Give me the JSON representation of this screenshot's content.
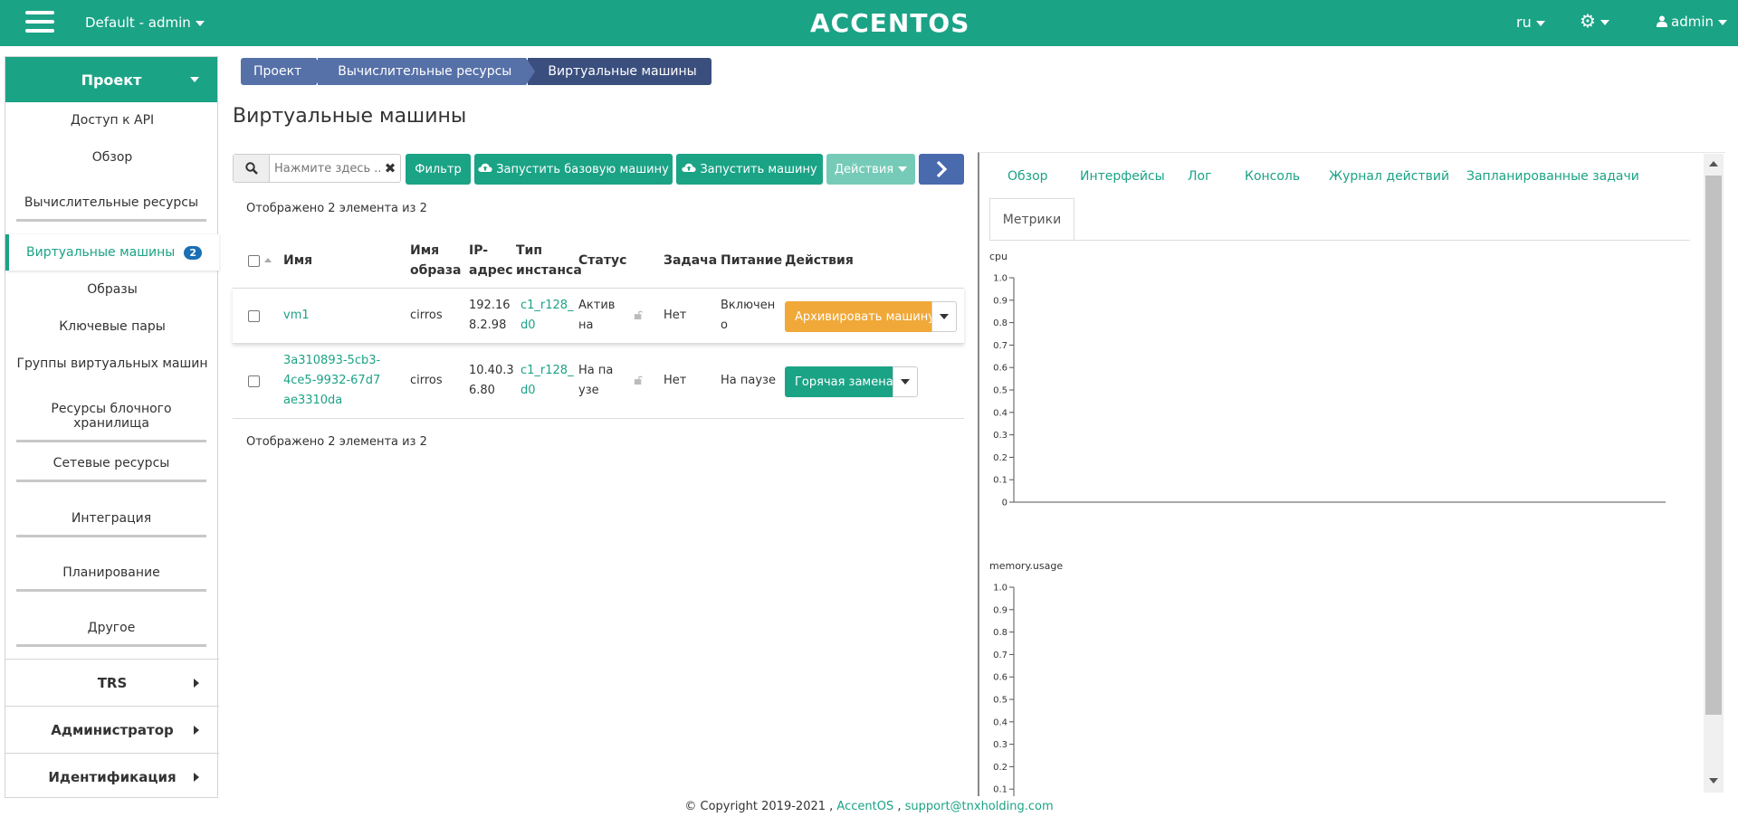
{
  "topbar": {
    "project": "Default - admin",
    "logo": "ACCENTOS",
    "lang": "ru",
    "user": "admin"
  },
  "sidebar": {
    "project_label": "Проект",
    "items": [
      "Доступ к API",
      "Обзор",
      "Вычислительные ресурсы",
      "Виртуальные машины",
      "Образы",
      "Ключевые пары",
      "Группы виртуальных машин",
      "Ресурсы блочного хранилища",
      "Сетевые ресурсы",
      "Интеграция",
      "Планирование",
      "Другое"
    ],
    "active_badge": "2",
    "sections": [
      "TRS",
      "Администратор",
      "Идентификация"
    ]
  },
  "breadcrumb": [
    "Проект",
    "Вычислительные ресурсы",
    "Виртуальные машины"
  ],
  "page_title": "Виртуальные машины",
  "toolbar": {
    "search_placeholder": "Нажмите здесь ...",
    "filter": "Фильтр",
    "launch_base": "Запустить базовую машину",
    "launch": "Запустить машину",
    "actions": "Действия"
  },
  "count_text": "Отображено 2 элемента из 2",
  "table": {
    "headers": {
      "name": "Имя",
      "image_1": "Имя",
      "image_2": "образа",
      "ip_1": "IP-",
      "ip_2": "адрес",
      "type_1": "Тип",
      "type_2": "инстанса",
      "status": "Статус",
      "task": "Задача",
      "power": "Питание",
      "actions": "Действия"
    },
    "rows": [
      {
        "name": "vm1",
        "image": "cirros",
        "ip_1": "192.16",
        "ip_2": "8.2.98",
        "type_1": "c1_r128_",
        "type_2": "d0",
        "status_1": "Актив",
        "status_2": "на",
        "task": "Нет",
        "power_1": "Включен",
        "power_2": "о",
        "action": "Архивировать машину",
        "action_color": "#f0a838"
      },
      {
        "name_1": "3a310893-5cb3-",
        "name_2": "4ce5-9932-67d7",
        "name_3": "ae3310da",
        "image": "cirros",
        "ip_1": "10.40.3",
        "ip_2": "6.80",
        "type_1": "c1_r128_",
        "type_2": "d0",
        "status_1": "На па",
        "status_2": "узе",
        "task": "Нет",
        "power": "На паузе",
        "action": "Горячая замена",
        "action_color": "#1ba386"
      }
    ]
  },
  "panel": {
    "tabs": [
      "Обзор",
      "Интерфейсы",
      "Лог",
      "Консоль",
      "Журнал действий",
      "Запланированные задачи"
    ],
    "active_tab": "Метрики",
    "charts": [
      {
        "label": "cpu",
        "ticks": [
          "1.0",
          "0.9",
          "0.8",
          "0.7",
          "0.6",
          "0.5",
          "0.4",
          "0.3",
          "0.2",
          "0.1",
          "0"
        ]
      },
      {
        "label": "memory.usage",
        "ticks": [
          "1.0",
          "0.9",
          "0.8",
          "0.7",
          "0.6",
          "0.5",
          "0.4",
          "0.3",
          "0.2",
          "0.1"
        ]
      }
    ]
  },
  "footer": {
    "copyright": "© Copyright 2019-2021 ,",
    "brand": "AccentOS",
    "sep": ",",
    "email": "support@tnxholding.com"
  }
}
